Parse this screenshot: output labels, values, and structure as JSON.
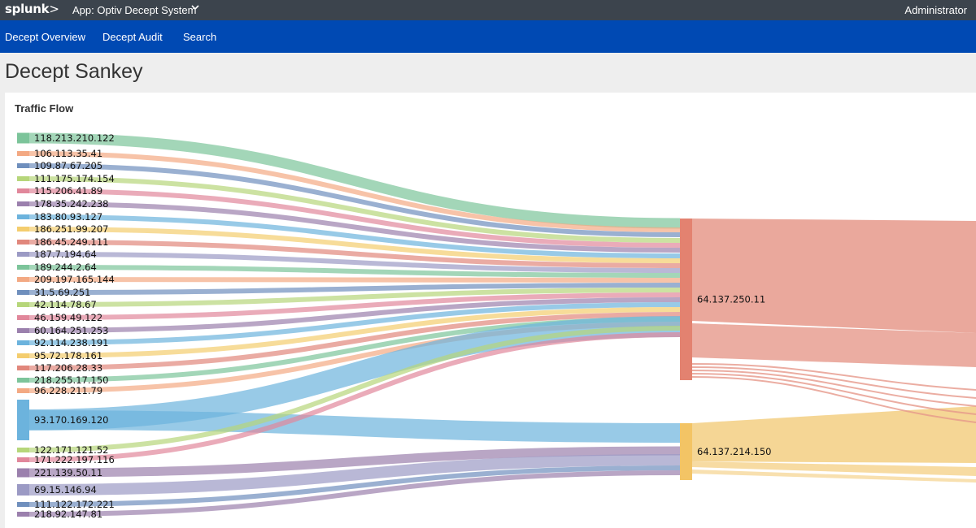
{
  "topbar": {
    "logo_text": "splunk",
    "logo_chevron": ">",
    "app_label": "App: Optiv Decept System",
    "app_caret_icon": "chevron-down-icon",
    "user": "Administrator"
  },
  "nav": {
    "items": [
      "Decept Overview",
      "Decept Audit",
      "Search"
    ]
  },
  "page": {
    "title": "Decept Sankey"
  },
  "panel": {
    "title": "Traffic Flow"
  },
  "colors": {
    "topbar": "#3c444d",
    "navbar": "#0049b3",
    "target_a": "#e38270",
    "target_b": "#f3c465"
  },
  "chart_data": {
    "type": "sankey",
    "sources": [
      {
        "label": "118.213.210.122",
        "color": "#7cc49a",
        "value": 3,
        "target": "64.137.250.11"
      },
      {
        "label": "106.113.35.41",
        "color": "#f3a983",
        "value": 1.6,
        "target": "64.137.250.11"
      },
      {
        "label": "109.87.67.205",
        "color": "#6f8fbd",
        "value": 1.6,
        "target": "64.137.250.11"
      },
      {
        "label": "111.175.174.154",
        "color": "#b6d67a",
        "value": 1.6,
        "target": "64.137.250.11"
      },
      {
        "label": "115.206.41.89",
        "color": "#e1879b",
        "value": 1.6,
        "target": "64.137.250.11"
      },
      {
        "label": "178.35.242.238",
        "color": "#9b80ad",
        "value": 1.6,
        "target": "64.137.250.11"
      },
      {
        "label": "183.80.93.127",
        "color": "#6cb3dd",
        "value": 1.6,
        "target": "64.137.250.11"
      },
      {
        "label": "186.251.99.207",
        "color": "#f4cd6e",
        "value": 1.6,
        "target": "64.137.250.11"
      },
      {
        "label": "186.45.249.111",
        "color": "#e1877c",
        "value": 1.6,
        "target": "64.137.250.11"
      },
      {
        "label": "187.7.194.64",
        "color": "#9b9ac4",
        "value": 1.6,
        "target": "64.137.250.11"
      },
      {
        "label": "189.244.2.64",
        "color": "#7cc49a",
        "value": 1.6,
        "target": "64.137.250.11"
      },
      {
        "label": "209.197.165.144",
        "color": "#f3a983",
        "value": 1.6,
        "target": "64.137.250.11"
      },
      {
        "label": "31.5.69.251",
        "color": "#6f8fbd",
        "value": 1.6,
        "target": "64.137.250.11"
      },
      {
        "label": "42.114.78.67",
        "color": "#b6d67a",
        "value": 1.6,
        "target": "64.137.250.11"
      },
      {
        "label": "46.159.49.122",
        "color": "#e1879b",
        "value": 1.6,
        "target": "64.137.250.11"
      },
      {
        "label": "60.164.251.253",
        "color": "#9b80ad",
        "value": 1.6,
        "target": "64.137.250.11"
      },
      {
        "label": "92.114.238.191",
        "color": "#6cb3dd",
        "value": 1.6,
        "target": "64.137.250.11"
      },
      {
        "label": "95.72.178.161",
        "color": "#f4cd6e",
        "value": 1.6,
        "target": "64.137.250.11"
      },
      {
        "label": "117.206.28.33",
        "color": "#e1877c",
        "value": 1.6,
        "target": "64.137.250.11"
      },
      {
        "label": "218.255.17.150",
        "color": "#7cc49a",
        "value": 1.6,
        "target": "64.137.250.11"
      },
      {
        "label": "96.228.211.79",
        "color": "#f3a983",
        "value": 1.6,
        "target": "64.137.250.11"
      },
      {
        "label": "93.170.169.120",
        "color": "#6cb3dd",
        "value": 12,
        "target": "64.137.250.11",
        "target2": "64.137.214.150"
      },
      {
        "label": "122.171.121.52",
        "color": "#b6d67a",
        "value": 1.6,
        "target": "64.137.250.11"
      },
      {
        "label": "171.222.197.116",
        "color": "#e1879b",
        "value": 1.6,
        "target": "64.137.250.11"
      },
      {
        "label": "221.139.50.11",
        "color": "#9b80ad",
        "value": 3,
        "target": "64.137.214.150"
      },
      {
        "label": "69.15.146.94",
        "color": "#9b9ac4",
        "value": 4,
        "target": "64.137.214.150"
      },
      {
        "label": "111.122.172.221",
        "color": "#6f8fbd",
        "value": 1.6,
        "target": "64.137.214.150"
      },
      {
        "label": "218.92.147.81",
        "color": "#9b80ad",
        "value": 1.6,
        "target": "64.137.214.150"
      }
    ],
    "targets": [
      {
        "label": "64.137.250.11",
        "color": "#e38270"
      },
      {
        "label": "64.137.214.150",
        "color": "#f3c465"
      }
    ]
  }
}
